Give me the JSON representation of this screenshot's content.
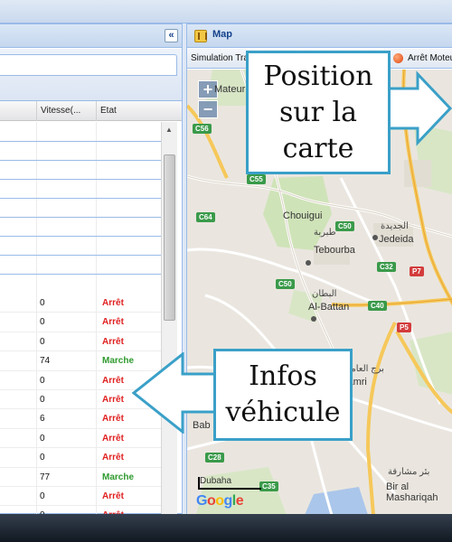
{
  "left_grid": {
    "collapse_glyph": "«",
    "columns": [
      "Vitesse(...",
      "Etat"
    ],
    "rows": [
      {
        "speed": "0",
        "etat": "Arrêt"
      },
      {
        "speed": "0",
        "etat": "Arrêt"
      },
      {
        "speed": "0",
        "etat": "Arrêt"
      },
      {
        "speed": "74",
        "etat": "Marche"
      },
      {
        "speed": "0",
        "etat": "Arrêt"
      },
      {
        "speed": "0",
        "etat": "Arrêt"
      },
      {
        "speed": "6",
        "etat": "Arrêt"
      },
      {
        "speed": "0",
        "etat": "Arrêt"
      },
      {
        "speed": "0",
        "etat": "Arrêt"
      },
      {
        "speed": "77",
        "etat": "Marche"
      },
      {
        "speed": "0",
        "etat": "Arrêt"
      },
      {
        "speed": "0",
        "etat": "Arrêt"
      }
    ],
    "colors": {
      "stop": "#e02020",
      "run": "#2f9a2f"
    }
  },
  "map_panel": {
    "title": "Map",
    "icon": "map-icon",
    "toolbar": {
      "simulation_label": "Simulation Trajet",
      "status_label": "Arrêt Moteur",
      "status_color": "#e0420a"
    },
    "zoom_in": "+",
    "zoom_out": "−",
    "places": {
      "mateur": "Mateur",
      "chouigui": "Chouigui",
      "tebourba_ar": "طبربة",
      "tebourba": "Tebourba",
      "jedeida_ar": "الجديدة",
      "jedeida": "Jedeida",
      "battan_ar": "البطان",
      "battan": "Al-Battan",
      "amri_ar": "برج العامري",
      "amri": "El Amri",
      "bab": "Bab",
      "mashariqah_ar": "بئر مشارقة",
      "mashariqah": "Bir al Mashariqah",
      "dubaha": "Dubaha"
    },
    "road_badges": [
      "C56",
      "C55",
      "C64",
      "C50",
      "P7",
      "C32",
      "C50",
      "C40",
      "P5",
      "C28",
      "C35",
      "P7"
    ],
    "google_logo": "Google"
  },
  "callouts": {
    "map_position": [
      "Position",
      "sur la",
      "carte"
    ],
    "vehicle_info": [
      "Infos",
      "véhicule"
    ],
    "color": "#3aa0c8"
  }
}
